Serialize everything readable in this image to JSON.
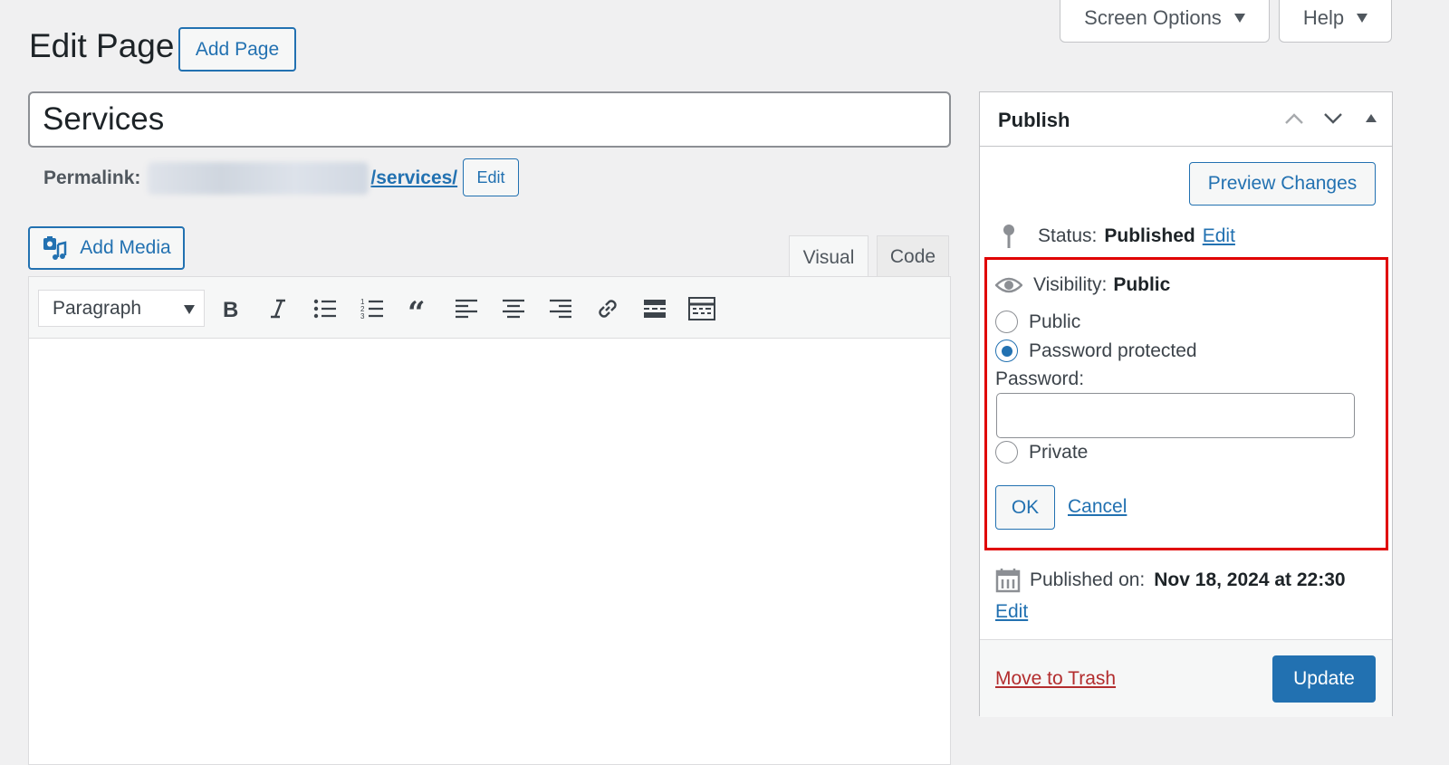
{
  "header": {
    "page_title": "Edit Page",
    "add_page_label": "Add Page",
    "screen_options_label": "Screen Options",
    "help_label": "Help"
  },
  "post": {
    "title_value": "Services",
    "permalink_label": "Permalink:",
    "permalink_slug": "/services/",
    "permalink_edit_label": "Edit"
  },
  "editor": {
    "add_media_label": "Add Media",
    "tabs": [
      {
        "label": "Visual",
        "active": true
      },
      {
        "label": "Code",
        "active": false
      }
    ],
    "format_select_value": "Paragraph",
    "toolbar_icons": [
      "bold-icon",
      "italic-icon",
      "bulleted-list-icon",
      "numbered-list-icon",
      "blockquote-icon",
      "align-left-icon",
      "align-center-icon",
      "align-right-icon",
      "link-icon",
      "read-more-icon",
      "toolbar-toggle-icon"
    ]
  },
  "publish": {
    "title": "Publish",
    "preview_label": "Preview Changes",
    "status_label": "Status:",
    "status_value": "Published",
    "status_edit": "Edit",
    "visibility_label": "Visibility:",
    "visibility_value": "Public",
    "options": [
      {
        "label": "Public",
        "checked": false
      },
      {
        "label": "Password protected",
        "checked": true
      },
      {
        "label": "Private",
        "checked": false
      }
    ],
    "password_label": "Password:",
    "password_value": "",
    "ok_label": "OK",
    "cancel_label": "Cancel",
    "published_on_label": "Published on:",
    "published_on_value": "Nov 18, 2024 at 22:30",
    "published_edit": "Edit",
    "trash_label": "Move to Trash",
    "update_label": "Update"
  },
  "colors": {
    "accent": "#2271b1",
    "highlight_border": "#e00000",
    "trash": "#b32d2e",
    "background": "#f0f0f1"
  }
}
